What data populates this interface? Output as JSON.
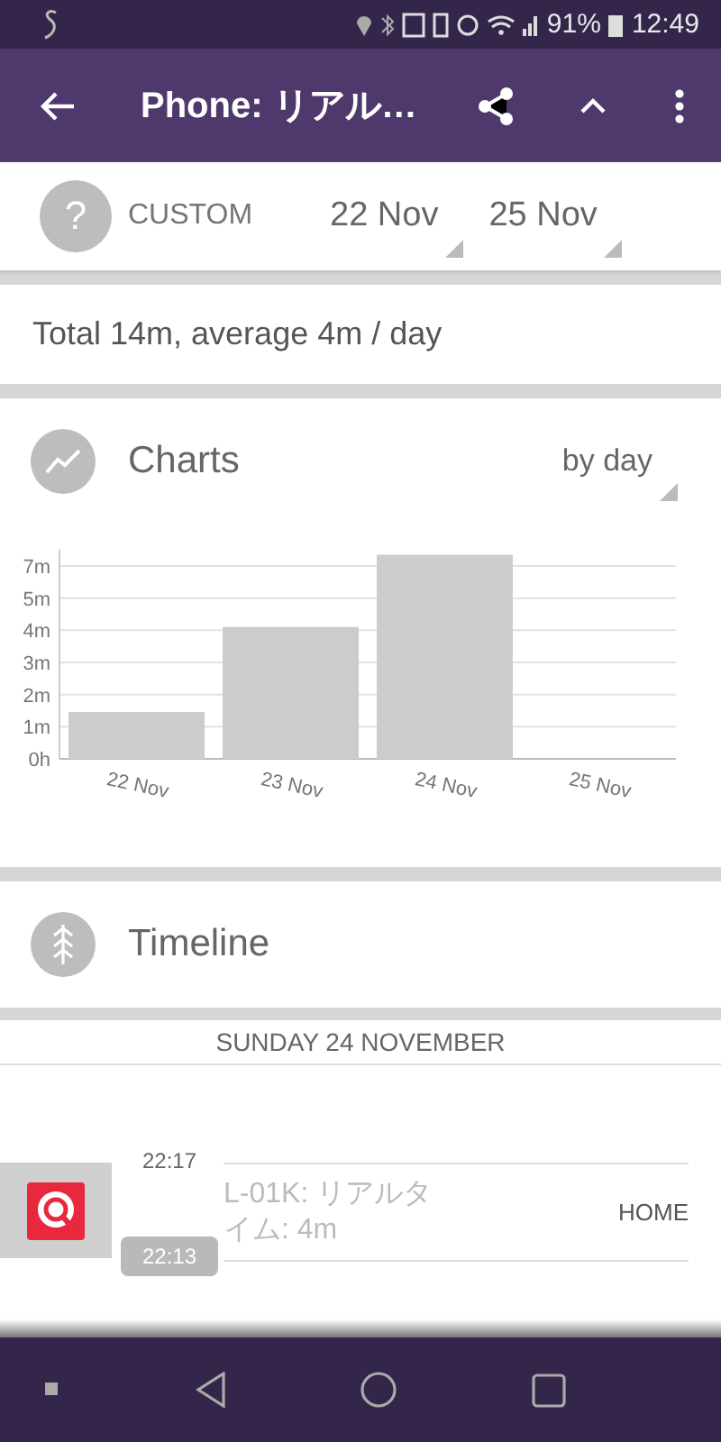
{
  "status_bar": {
    "battery": "91%",
    "time": "12:49"
  },
  "app_bar": {
    "title": "Phone: リアル…"
  },
  "range": {
    "mode": "CUSTOM",
    "mode_icon": "?",
    "from": "22 Nov",
    "to": "25 Nov"
  },
  "summary": "Total 14m, average 4m / day",
  "charts": {
    "title": "Charts",
    "grouping": "by day",
    "chart_data": {
      "type": "bar",
      "categories": [
        "22 Nov",
        "23 Nov",
        "24 Nov",
        "25 Nov"
      ],
      "values": [
        1.59,
        4.47,
        6.92,
        0
      ],
      "ylim": [
        0,
        7.1
      ],
      "grid": true,
      "yticks": [
        {
          "value": 0,
          "label": "0h"
        },
        {
          "value": 1.09,
          "label": "1m"
        },
        {
          "value": 2.18,
          "label": "2m"
        },
        {
          "value": 3.27,
          "label": "3m"
        },
        {
          "value": 4.36,
          "label": "4m"
        },
        {
          "value": 5.45,
          "label": "5m"
        },
        {
          "value": 6.54,
          "label": "7m"
        }
      ]
    }
  },
  "timeline": {
    "title": "Timeline",
    "day": "SUNDAY 24 NOVEMBER",
    "entries": [
      {
        "end": "22:17",
        "start": "22:13",
        "label": "L-01K: リアルタイム: 4m",
        "place": "HOME"
      }
    ]
  }
}
